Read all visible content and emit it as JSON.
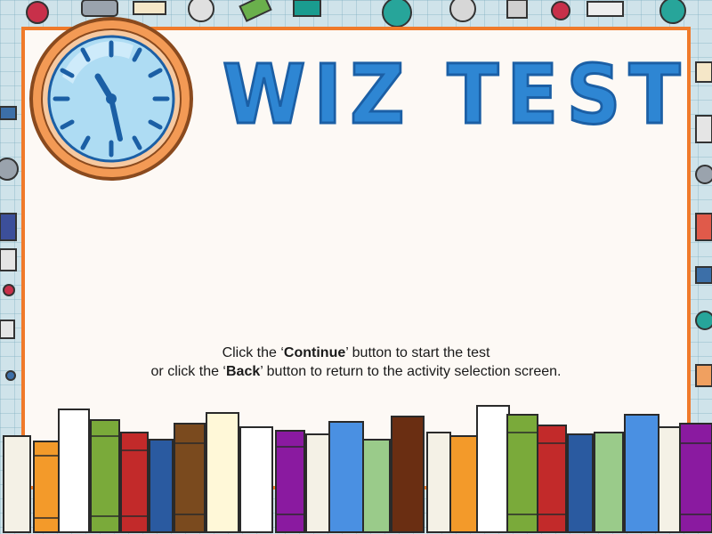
{
  "title": "WIZ TEST",
  "instructions": {
    "line1_pre": "Click the ‘",
    "line1_bold": "Continue",
    "line1_post": "’ button to start the test",
    "line2_pre": "or click the ‘",
    "line2_bold": "Back",
    "line2_post": "’ button to return to the activity selection screen."
  },
  "colors": {
    "border": "#f07a2a",
    "card": "#fdf9f5",
    "title_fill": "#2e86d3",
    "title_stroke": "#1b5fa5",
    "clock_face": "#aedcf3",
    "clock_rim": "#f0a060"
  },
  "icons": {
    "clock": "wall-clock-icon",
    "books": "bookshelf-illustration"
  }
}
